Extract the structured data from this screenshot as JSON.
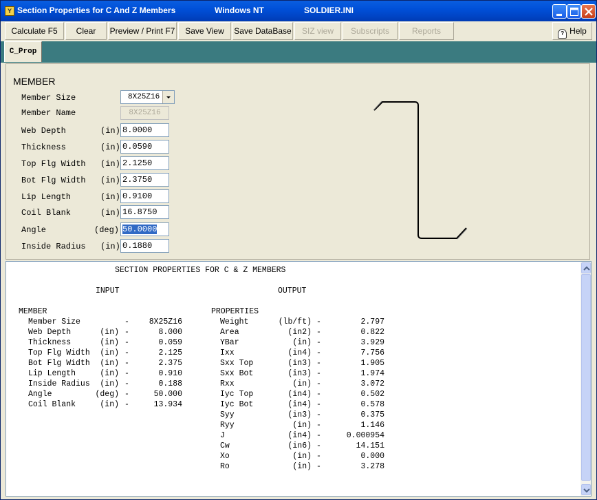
{
  "window": {
    "title": "Section Properties for C And Z Members",
    "os": "Windows NT",
    "ini": "SOLDIER.INI"
  },
  "toolbar": {
    "calculate": "Calculate  F5",
    "clear": "Clear",
    "preview": "Preview / Print F7",
    "save_view": "Save View",
    "save_db": "Save DataBase",
    "siz_view": "SIZ view",
    "subscripts": "Subscripts",
    "reports": "Reports",
    "help": "Help"
  },
  "tab": {
    "label": "C_Prop"
  },
  "member": {
    "title": "MEMBER",
    "size": {
      "label": "Member Size",
      "value": "8X25Z16"
    },
    "name": {
      "label": "Member Name",
      "value": "8X25Z16"
    },
    "fields": [
      {
        "label": "Web Depth",
        "unit": "(in)",
        "value": "8.0000"
      },
      {
        "label": "Thickness",
        "unit": "(in)",
        "value": "0.0590"
      },
      {
        "label": "Top Flg Width",
        "unit": "(in)",
        "value": "2.1250"
      },
      {
        "label": "Bot Flg Width",
        "unit": "(in)",
        "value": "2.3750"
      },
      {
        "label": "Lip Length",
        "unit": "(in)",
        "value": "0.9100"
      },
      {
        "label": "Coil Blank",
        "unit": "(in)",
        "value": "16.8750"
      },
      {
        "label": "Angle",
        "unit": "(deg)",
        "value": "50.0000"
      },
      {
        "label": "Inside Radius",
        "unit": "(in)",
        "value": "0.1880"
      }
    ]
  },
  "report": {
    "title": "SECTION PROPERTIES FOR C & Z MEMBERS",
    "input_heading": "INPUT",
    "output_heading": "OUTPUT",
    "member_heading": "MEMBER",
    "properties_heading": "PROPERTIES",
    "inputs": [
      {
        "label": "Member Size",
        "unit": "",
        "value": "8X25Z16"
      },
      {
        "label": "Web Depth",
        "unit": "(in)",
        "value": "8.000"
      },
      {
        "label": "Thickness",
        "unit": "(in)",
        "value": "0.059"
      },
      {
        "label": "Top Flg Width",
        "unit": "(in)",
        "value": "2.125"
      },
      {
        "label": "Bot Flg Width",
        "unit": "(in)",
        "value": "2.375"
      },
      {
        "label": "Lip Length",
        "unit": "(in)",
        "value": "0.910"
      },
      {
        "label": "Inside Radius",
        "unit": "(in)",
        "value": "0.188"
      },
      {
        "label": "Angle",
        "unit": "(deg)",
        "value": "50.000"
      },
      {
        "label": "Coil Blank",
        "unit": "(in)",
        "value": "13.934"
      }
    ],
    "outputs": [
      {
        "label": "Weight",
        "unit": "(lb/ft)",
        "value": "2.797"
      },
      {
        "label": "Area",
        "unit": "(in2)",
        "value": "0.822"
      },
      {
        "label": "YBar",
        "unit": "(in)",
        "value": "3.929"
      },
      {
        "label": "Ixx",
        "unit": "(in4)",
        "value": "7.756"
      },
      {
        "label": "Sxx Top",
        "unit": "(in3)",
        "value": "1.905"
      },
      {
        "label": "Sxx Bot",
        "unit": "(in3)",
        "value": "1.974"
      },
      {
        "label": "Rxx",
        "unit": "(in)",
        "value": "3.072"
      },
      {
        "label": "Iyc Top",
        "unit": "(in4)",
        "value": "0.502"
      },
      {
        "label": "Iyc Bot",
        "unit": "(in4)",
        "value": "0.578"
      },
      {
        "label": "Syy",
        "unit": "(in3)",
        "value": "0.375"
      },
      {
        "label": "Ryy",
        "unit": "(in)",
        "value": "1.146"
      },
      {
        "label": "J",
        "unit": "(in4)",
        "value": "0.000954"
      },
      {
        "label": "Cw",
        "unit": "(in6)",
        "value": "14.151"
      },
      {
        "label": "Xo",
        "unit": "(in)",
        "value": "0.000"
      },
      {
        "label": "Ro",
        "unit": "(in)",
        "value": "3.278"
      }
    ]
  }
}
